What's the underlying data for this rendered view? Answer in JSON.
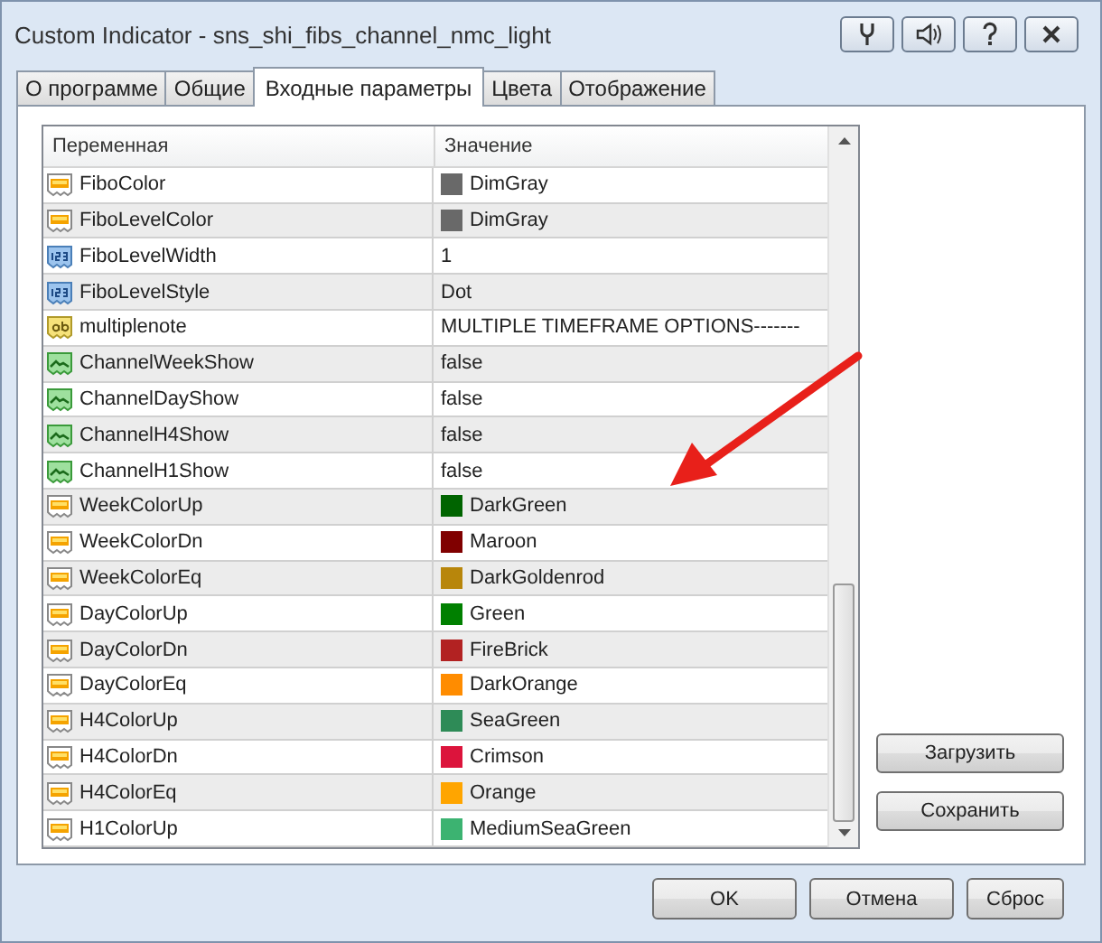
{
  "window": {
    "title": "Custom Indicator - sns_shi_fibs_channel_nmc_light"
  },
  "tabs": [
    {
      "label": "О программе",
      "selected": false
    },
    {
      "label": "Общие",
      "selected": false
    },
    {
      "label": "Входные параметры",
      "selected": true
    },
    {
      "label": "Цвета",
      "selected": false
    },
    {
      "label": "Отображение",
      "selected": false
    }
  ],
  "table": {
    "columns": [
      "Переменная",
      "Значение"
    ],
    "rows": [
      {
        "kind": "color",
        "name": "FiboColor",
        "value": "DimGray",
        "color": "#696969"
      },
      {
        "kind": "color",
        "name": "FiboLevelColor",
        "value": "DimGray",
        "color": "#696969"
      },
      {
        "kind": "number",
        "name": "FiboLevelWidth",
        "value": "1"
      },
      {
        "kind": "number",
        "name": "FiboLevelStyle",
        "value": "Dot"
      },
      {
        "kind": "string",
        "name": "multiplenote",
        "value": "MULTIPLE TIMEFRAME OPTIONS-------"
      },
      {
        "kind": "bool",
        "name": "ChannelWeekShow",
        "value": "false"
      },
      {
        "kind": "bool",
        "name": "ChannelDayShow",
        "value": "false"
      },
      {
        "kind": "bool",
        "name": "ChannelH4Show",
        "value": "false"
      },
      {
        "kind": "bool",
        "name": "ChannelH1Show",
        "value": "false"
      },
      {
        "kind": "color",
        "name": "WeekColorUp",
        "value": "DarkGreen",
        "color": "#006400"
      },
      {
        "kind": "color",
        "name": "WeekColorDn",
        "value": "Maroon",
        "color": "#800000"
      },
      {
        "kind": "color",
        "name": "WeekColorEq",
        "value": "DarkGoldenrod",
        "color": "#b8860b"
      },
      {
        "kind": "color",
        "name": "DayColorUp",
        "value": "Green",
        "color": "#008000"
      },
      {
        "kind": "color",
        "name": "DayColorDn",
        "value": "FireBrick",
        "color": "#b22222"
      },
      {
        "kind": "color",
        "name": "DayColorEq",
        "value": "DarkOrange",
        "color": "#ff8c00"
      },
      {
        "kind": "color",
        "name": "H4ColorUp",
        "value": "SeaGreen",
        "color": "#2e8b57"
      },
      {
        "kind": "color",
        "name": "H4ColorDn",
        "value": "Crimson",
        "color": "#dc143c"
      },
      {
        "kind": "color",
        "name": "H4ColorEq",
        "value": "Orange",
        "color": "#ffa500"
      },
      {
        "kind": "color",
        "name": "H1ColorUp",
        "value": "MediumSeaGreen",
        "color": "#3cb371"
      }
    ]
  },
  "side_buttons": [
    "Загрузить",
    "Сохранить"
  ],
  "footer_buttons": [
    "OK",
    "Отмена",
    "Сброс"
  ]
}
